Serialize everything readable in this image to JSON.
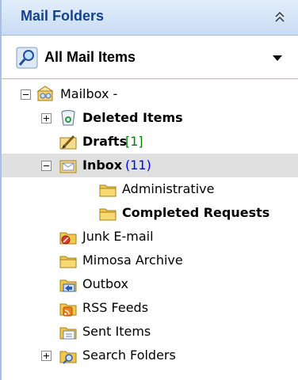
{
  "header": {
    "title": "Mail Folders"
  },
  "selector": {
    "label": "All Mail Items"
  },
  "tree": {
    "mailbox": "Mailbox -",
    "deleted": "Deleted Items",
    "drafts": "Drafts",
    "drafts_count": "[1]",
    "inbox": "Inbox",
    "inbox_count": "(11)",
    "administrative": "Administrative",
    "completed": "Completed Requests",
    "junk": "Junk E-mail",
    "archive": "Mimosa Archive",
    "outbox": "Outbox",
    "rss": "RSS Feeds",
    "sent": "Sent Items",
    "search": "Search Folders"
  },
  "colors": {
    "header_text": "#15428b",
    "unread_count": "#0000ff",
    "draft_count": "#008000",
    "selected_row": "#e0e0e0"
  },
  "icons": [
    "collapse-chevrons-icon",
    "search-magnifier-icon",
    "mailbox-icon",
    "recycle-bin-icon",
    "drafts-icon",
    "inbox-icon",
    "folder-icon",
    "junk-folder-icon",
    "outbox-icon",
    "rss-folder-icon",
    "sent-folder-icon",
    "search-folder-icon"
  ]
}
